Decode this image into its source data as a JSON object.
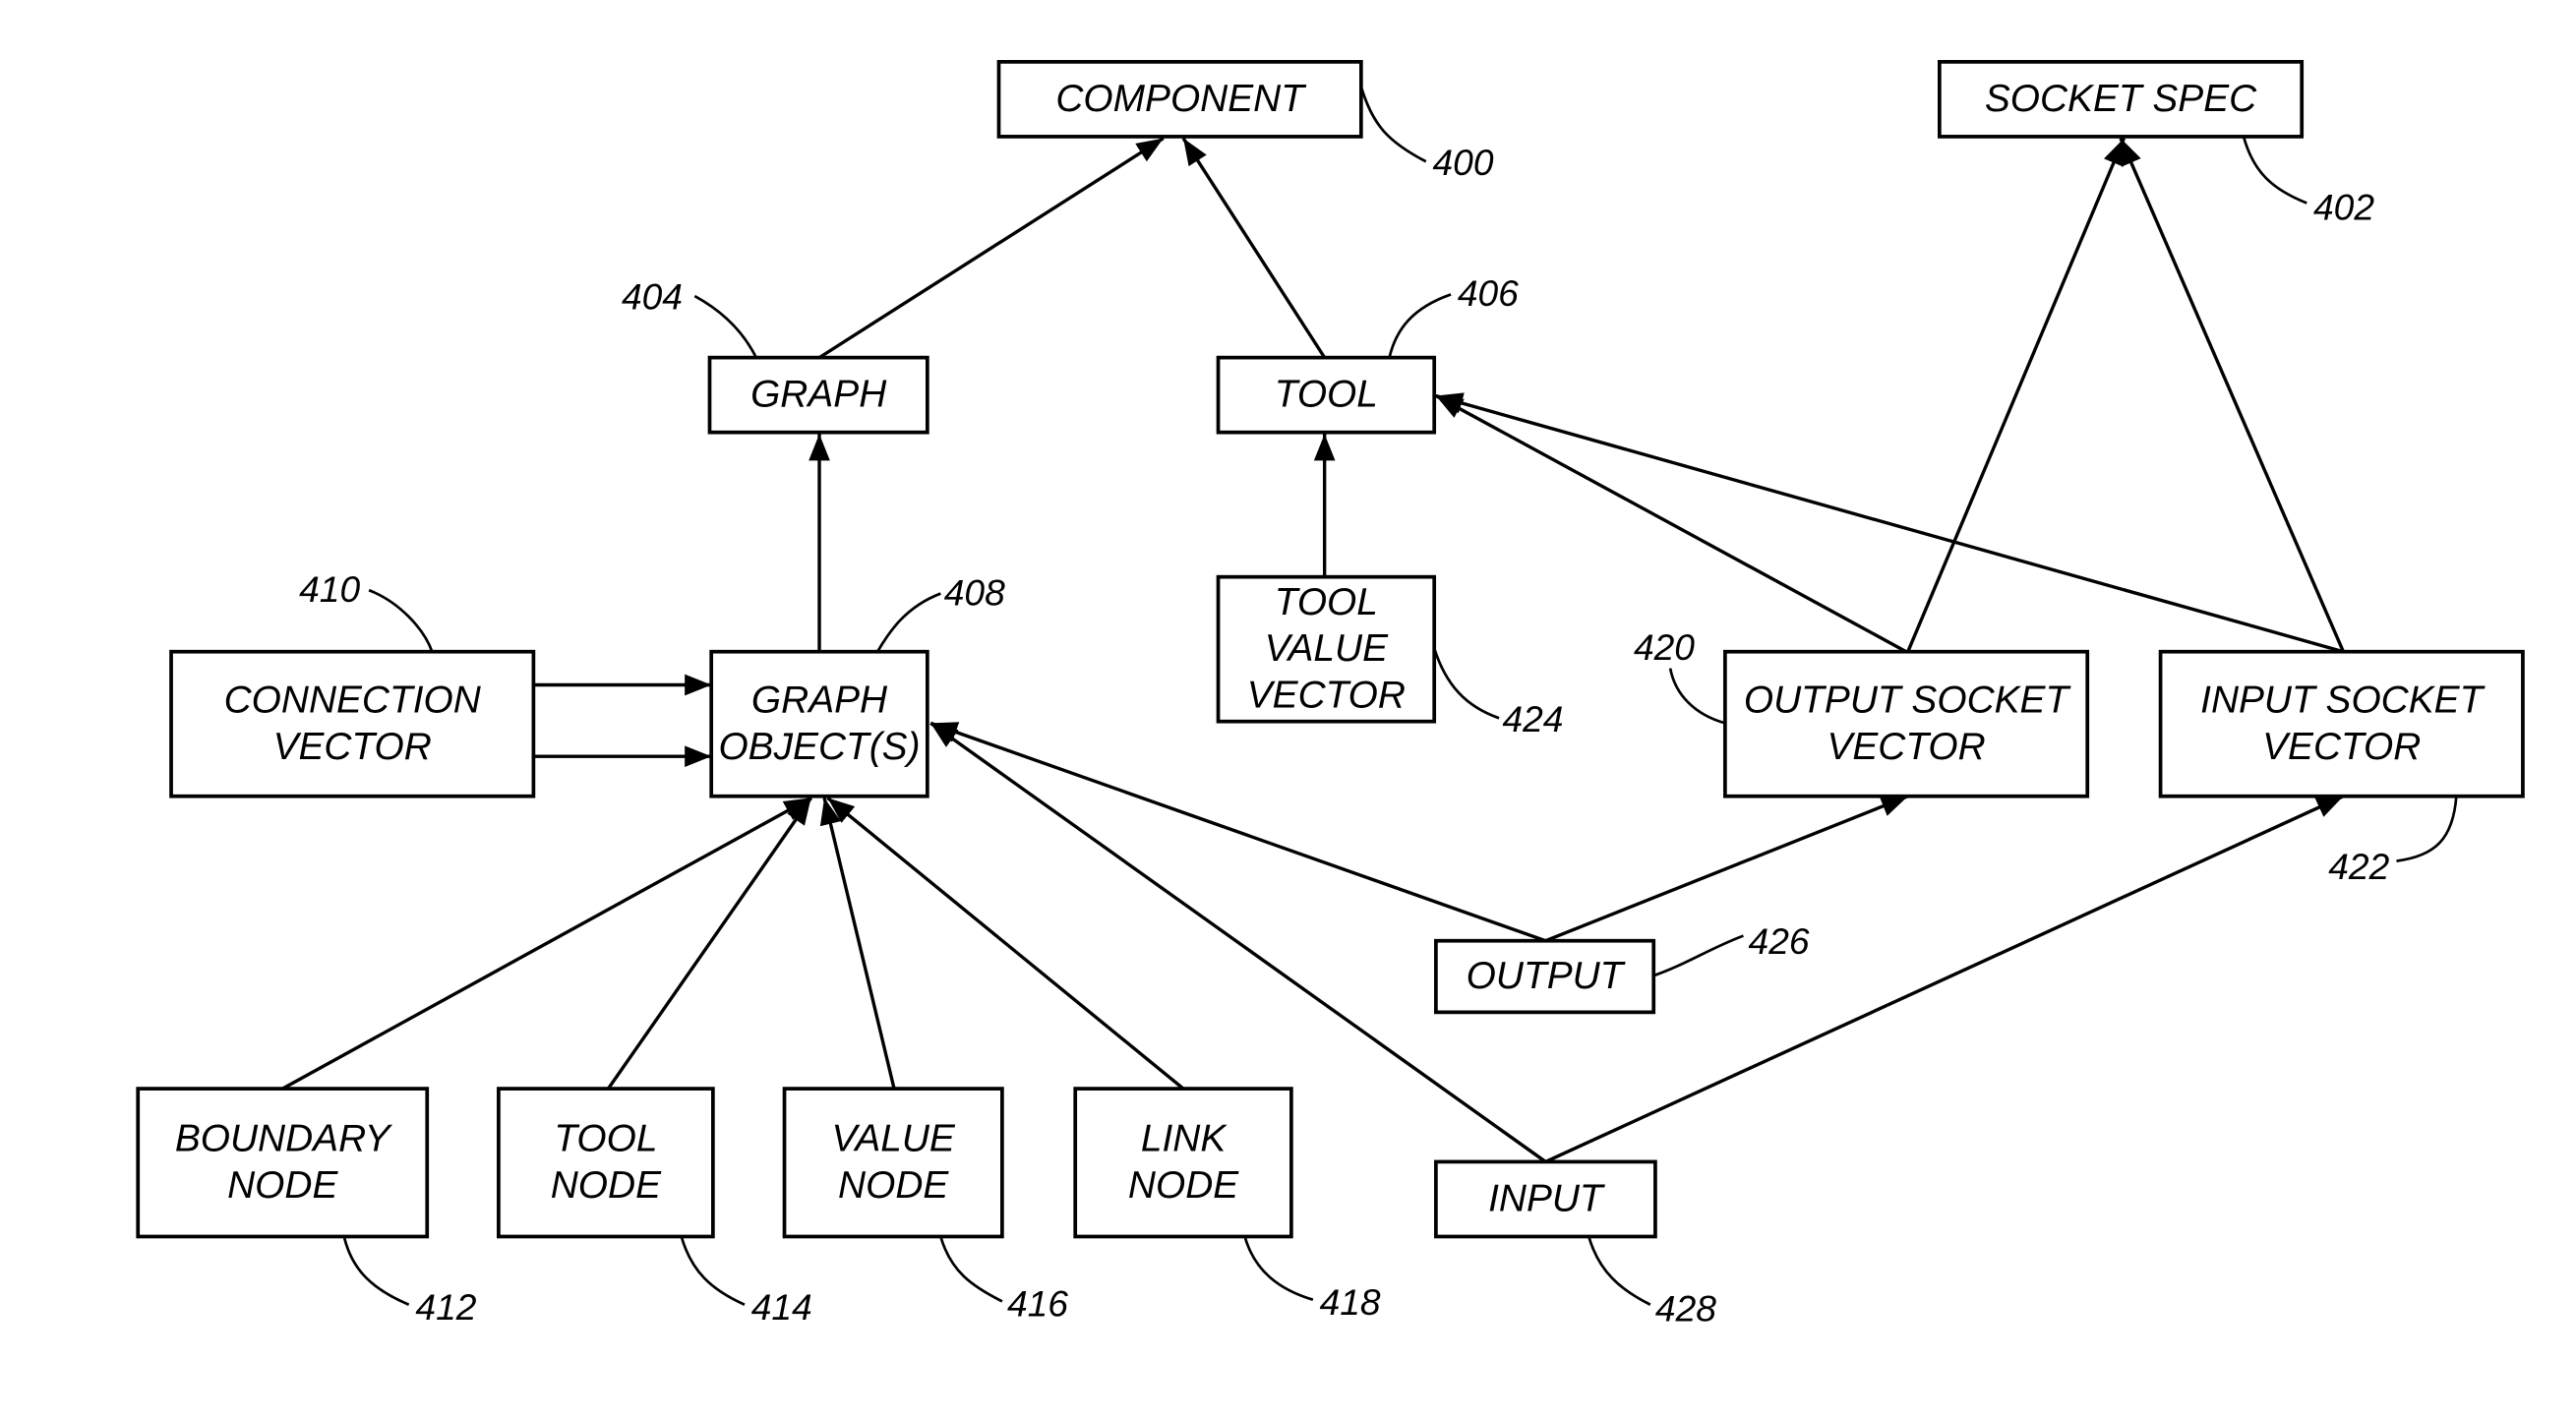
{
  "figure": {
    "nodes": [
      {
        "id": "component",
        "ref": "400",
        "lines": [
          "COMPONENT"
        ]
      },
      {
        "id": "socket-spec",
        "ref": "402",
        "lines": [
          "SOCKET SPEC"
        ]
      },
      {
        "id": "graph",
        "ref": "404",
        "lines": [
          "GRAPH"
        ]
      },
      {
        "id": "tool",
        "ref": "406",
        "lines": [
          "TOOL"
        ]
      },
      {
        "id": "graph-objects",
        "ref": "408",
        "lines": [
          "GRAPH",
          "OBJECT(S)"
        ]
      },
      {
        "id": "connection-vector",
        "ref": "410",
        "lines": [
          "CONNECTION",
          "VECTOR"
        ]
      },
      {
        "id": "boundary-node",
        "ref": "412",
        "lines": [
          "BOUNDARY",
          "NODE"
        ]
      },
      {
        "id": "tool-node",
        "ref": "414",
        "lines": [
          "TOOL",
          "NODE"
        ]
      },
      {
        "id": "value-node",
        "ref": "416",
        "lines": [
          "VALUE",
          "NODE"
        ]
      },
      {
        "id": "link-node",
        "ref": "418",
        "lines": [
          "LINK",
          "NODE"
        ]
      },
      {
        "id": "output-socket-vector",
        "ref": "420",
        "lines": [
          "OUTPUT SOCKET",
          "VECTOR"
        ]
      },
      {
        "id": "input-socket-vector",
        "ref": "422",
        "lines": [
          "INPUT SOCKET",
          "VECTOR"
        ]
      },
      {
        "id": "tool-value-vector",
        "ref": "424",
        "lines": [
          "TOOL",
          "VALUE",
          "VECTOR"
        ]
      },
      {
        "id": "output",
        "ref": "426",
        "lines": [
          "OUTPUT"
        ]
      },
      {
        "id": "input",
        "ref": "428",
        "lines": [
          "INPUT"
        ]
      }
    ],
    "edges": [
      {
        "from": "graph",
        "to": "component"
      },
      {
        "from": "tool",
        "to": "component"
      },
      {
        "from": "output-socket-vector",
        "to": "socket-spec"
      },
      {
        "from": "input-socket-vector",
        "to": "socket-spec"
      },
      {
        "from": "graph-objects",
        "to": "graph"
      },
      {
        "from": "tool-value-vector",
        "to": "tool"
      },
      {
        "from": "output-socket-vector",
        "to": "tool"
      },
      {
        "from": "input-socket-vector",
        "to": "tool"
      },
      {
        "from": "connection-vector",
        "to": "graph-objects"
      },
      {
        "from": "connection-vector",
        "to": "graph-objects"
      },
      {
        "from": "boundary-node",
        "to": "graph-objects"
      },
      {
        "from": "tool-node",
        "to": "graph-objects"
      },
      {
        "from": "value-node",
        "to": "graph-objects"
      },
      {
        "from": "link-node",
        "to": "graph-objects"
      },
      {
        "from": "output",
        "to": "graph-objects"
      },
      {
        "from": "input",
        "to": "graph-objects"
      },
      {
        "from": "output",
        "to": "output-socket-vector"
      },
      {
        "from": "input",
        "to": "input-socket-vector"
      }
    ]
  }
}
